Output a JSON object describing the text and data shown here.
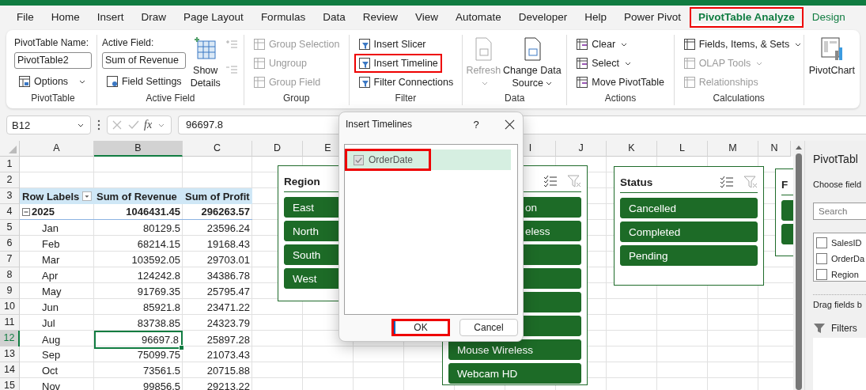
{
  "tabs": [
    {
      "label": "File",
      "selected": false,
      "contextual": false,
      "highlighted": false
    },
    {
      "label": "Home",
      "selected": false,
      "contextual": false,
      "highlighted": false
    },
    {
      "label": "Insert",
      "selected": false,
      "contextual": false,
      "highlighted": false
    },
    {
      "label": "Draw",
      "selected": false,
      "contextual": false,
      "highlighted": false
    },
    {
      "label": "Page Layout",
      "selected": false,
      "contextual": false,
      "highlighted": false
    },
    {
      "label": "Formulas",
      "selected": false,
      "contextual": false,
      "highlighted": false
    },
    {
      "label": "Data",
      "selected": false,
      "contextual": false,
      "highlighted": false
    },
    {
      "label": "Review",
      "selected": false,
      "contextual": false,
      "highlighted": false
    },
    {
      "label": "View",
      "selected": false,
      "contextual": false,
      "highlighted": false
    },
    {
      "label": "Automate",
      "selected": false,
      "contextual": false,
      "highlighted": false
    },
    {
      "label": "Developer",
      "selected": false,
      "contextual": false,
      "highlighted": false
    },
    {
      "label": "Help",
      "selected": false,
      "contextual": false,
      "highlighted": false
    },
    {
      "label": "Power Pivot",
      "selected": false,
      "contextual": false,
      "highlighted": false
    },
    {
      "label": "PivotTable Analyze",
      "selected": true,
      "contextual": true,
      "highlighted": true
    },
    {
      "label": "Design",
      "selected": false,
      "contextual": true,
      "highlighted": false
    }
  ],
  "ribbon": {
    "pivottable": {
      "name_label": "PivotTable Name:",
      "name_value": "PivotTable2",
      "options": {
        "label": "Options",
        "dropdown": true
      },
      "group_label": "PivotTable"
    },
    "active_field": {
      "label": "Active Field:",
      "value": "Sum of Revenue",
      "field_settings": "Field Settings",
      "show_details": "Show Details",
      "group_label": "Active Field"
    },
    "group": {
      "items": [
        {
          "label": "Group Selection",
          "disabled": true
        },
        {
          "label": "Ungroup",
          "disabled": true
        },
        {
          "label": "Group Field",
          "disabled": true
        }
      ],
      "group_label": "Group"
    },
    "filter": {
      "items": [
        {
          "label": "Insert Slicer",
          "highlighted": false
        },
        {
          "label": "Insert Timeline",
          "highlighted": true
        },
        {
          "label": "Filter Connections",
          "highlighted": false
        }
      ],
      "group_label": "Filter"
    },
    "data": {
      "items": [
        {
          "label": "Refresh",
          "disabled": true,
          "dropdown": true
        },
        {
          "label": "Change Data Source",
          "disabled": false,
          "dropdown": true
        }
      ],
      "group_label": "Data"
    },
    "actions": {
      "items": [
        {
          "label": "Clear",
          "dropdown": true
        },
        {
          "label": "Select",
          "dropdown": true
        },
        {
          "label": "Move PivotTable",
          "dropdown": false
        }
      ],
      "group_label": "Actions"
    },
    "calculations": {
      "items": [
        {
          "label": "Fields, Items, & Sets",
          "dropdown": true,
          "disabled": false
        },
        {
          "label": "OLAP Tools",
          "dropdown": true,
          "disabled": true
        },
        {
          "label": "Relationships",
          "dropdown": false,
          "disabled": true
        }
      ],
      "group_label": "Calculations"
    },
    "pivotchart": {
      "label": "PivotChart"
    }
  },
  "formula_bar": {
    "name_box": "B12",
    "function_label": "fx",
    "value": "96697.8"
  },
  "sheet": {
    "columns": [
      {
        "label": "A",
        "selected": false
      },
      {
        "label": "B",
        "selected": true
      },
      {
        "label": "C",
        "selected": false
      },
      {
        "label": "D",
        "selected": false
      },
      {
        "label": "E",
        "selected": false
      },
      {
        "label": "I",
        "selected": false
      },
      {
        "label": "J",
        "selected": false
      },
      {
        "label": "K",
        "selected": false
      },
      {
        "label": "L",
        "selected": false
      },
      {
        "label": "M",
        "selected": false
      },
      {
        "label": "N",
        "selected": false
      }
    ],
    "row_numbers": [
      {
        "label": "1",
        "selected": false
      },
      {
        "label": "2",
        "selected": false
      },
      {
        "label": "3",
        "selected": false
      },
      {
        "label": "4",
        "selected": false
      },
      {
        "label": "5",
        "selected": false
      },
      {
        "label": "6",
        "selected": false
      },
      {
        "label": "7",
        "selected": false
      },
      {
        "label": "8",
        "selected": false
      },
      {
        "label": "9",
        "selected": false
      },
      {
        "label": "10",
        "selected": false
      },
      {
        "label": "11",
        "selected": false
      },
      {
        "label": "12",
        "selected": true
      },
      {
        "label": "13",
        "selected": false
      },
      {
        "label": "14",
        "selected": false
      },
      {
        "label": "15",
        "selected": false
      }
    ],
    "pivot": {
      "headers": [
        "Row Labels",
        "Sum of Revenue",
        "Sum of Profit"
      ],
      "total": {
        "label": "2025",
        "expanded": true,
        "revenue": "1046431.45",
        "profit": "296263.57"
      },
      "rows": [
        {
          "label": "Jan",
          "revenue": "80129.5",
          "profit": "23596.24",
          "selected": false
        },
        {
          "label": "Feb",
          "revenue": "68214.15",
          "profit": "19168.43",
          "selected": false
        },
        {
          "label": "Mar",
          "revenue": "103592.05",
          "profit": "29703.01",
          "selected": false
        },
        {
          "label": "Apr",
          "revenue": "124242.8",
          "profit": "34386.78",
          "selected": false
        },
        {
          "label": "May",
          "revenue": "91769.35",
          "profit": "25795.47",
          "selected": false
        },
        {
          "label": "Jun",
          "revenue": "85921.8",
          "profit": "23471.22",
          "selected": false
        },
        {
          "label": "Jul",
          "revenue": "83738.85",
          "profit": "24323.79",
          "selected": false
        },
        {
          "label": "Aug",
          "revenue": "96697.8",
          "profit": "25897.28",
          "selected": true
        },
        {
          "label": "Sep",
          "revenue": "75099.75",
          "profit": "21073.43",
          "selected": false
        },
        {
          "label": "Oct",
          "revenue": "73561.5",
          "profit": "20715.88",
          "selected": false
        },
        {
          "label": "Nov",
          "revenue": "99856.5",
          "profit": "29213.22",
          "selected": false
        }
      ]
    }
  },
  "slicers": [
    {
      "title": "Region",
      "controls": false,
      "items": [
        {
          "label": "East",
          "selected": true
        },
        {
          "label": "North",
          "selected": true
        },
        {
          "label": "South",
          "selected": true
        },
        {
          "label": "West",
          "selected": true
        }
      ]
    },
    {
      "controls": true,
      "items": [
        {
          "label": "on",
          "partial": true,
          "selected": true
        },
        {
          "label": "eless",
          "partial": true,
          "selected": true
        },
        {
          "selected": true
        },
        {
          "selected": true
        },
        {
          "selected": true
        },
        {
          "selected": true
        },
        {
          "label": "Mouse Wireless",
          "partial": false,
          "selected": true
        },
        {
          "label": "Webcam HD",
          "partial": false,
          "selected": true
        }
      ]
    },
    {
      "title": "Status",
      "controls": true,
      "items": [
        {
          "label": "Cancelled",
          "selected": true
        },
        {
          "label": "Completed",
          "selected": true
        },
        {
          "label": "Pending",
          "selected": true
        }
      ]
    },
    {
      "title": "F",
      "controls": false,
      "items": [
        {
          "selected": true
        },
        {
          "selected": true
        }
      ]
    }
  ],
  "dialog": {
    "title": "Insert Timelines",
    "help": "?",
    "fields": [
      {
        "label": "OrderDate",
        "checked": true,
        "disabled": true,
        "selected": true,
        "highlighted": true
      }
    ],
    "buttons": [
      {
        "label": "OK",
        "default": true,
        "highlighted": true
      },
      {
        "label": "Cancel",
        "default": false,
        "highlighted": false
      }
    ]
  },
  "task_pane": {
    "title": "PivotTabl",
    "subtitle": "Choose field",
    "search_placeholder": "Search",
    "fields": [
      {
        "label": "SalesID",
        "checked": false
      },
      {
        "label": "OrderDa",
        "checked": false
      },
      {
        "label": "Region",
        "checked": false
      }
    ],
    "drag_hint": "Drag fields b",
    "areas": [
      {
        "label": "Filters"
      }
    ]
  }
}
